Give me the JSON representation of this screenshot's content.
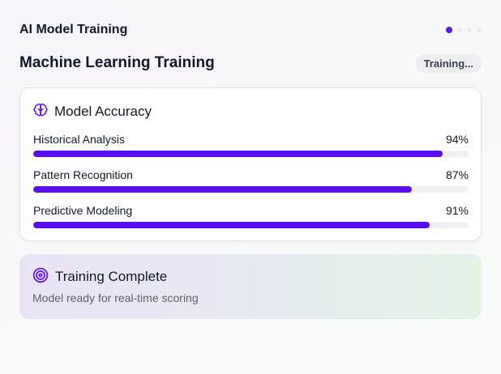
{
  "app": {
    "title": "AI Model Training"
  },
  "steps": {
    "count": 4,
    "active_index": 0
  },
  "section": {
    "title": "Machine Learning Training",
    "status": "Training..."
  },
  "accuracy": {
    "title": "Model Accuracy",
    "icon": "brain-icon",
    "metrics": [
      {
        "label": "Historical Analysis",
        "value_text": "94%",
        "value": 0.94
      },
      {
        "label": "Pattern Recognition",
        "value_text": "87%",
        "value": 0.87
      },
      {
        "label": "Predictive Modeling",
        "value_text": "91%",
        "value": 0.91
      }
    ]
  },
  "completion": {
    "title": "Training Complete",
    "subtitle": "Model ready for real-time scoring",
    "icon": "target-icon"
  },
  "colors": {
    "accent": "#5b0ef0",
    "track": "#eef0f4",
    "card_border": "#e3e1e8",
    "complete_gradient_start": "#e9e3f6",
    "complete_gradient_end": "#e3f3e6"
  }
}
